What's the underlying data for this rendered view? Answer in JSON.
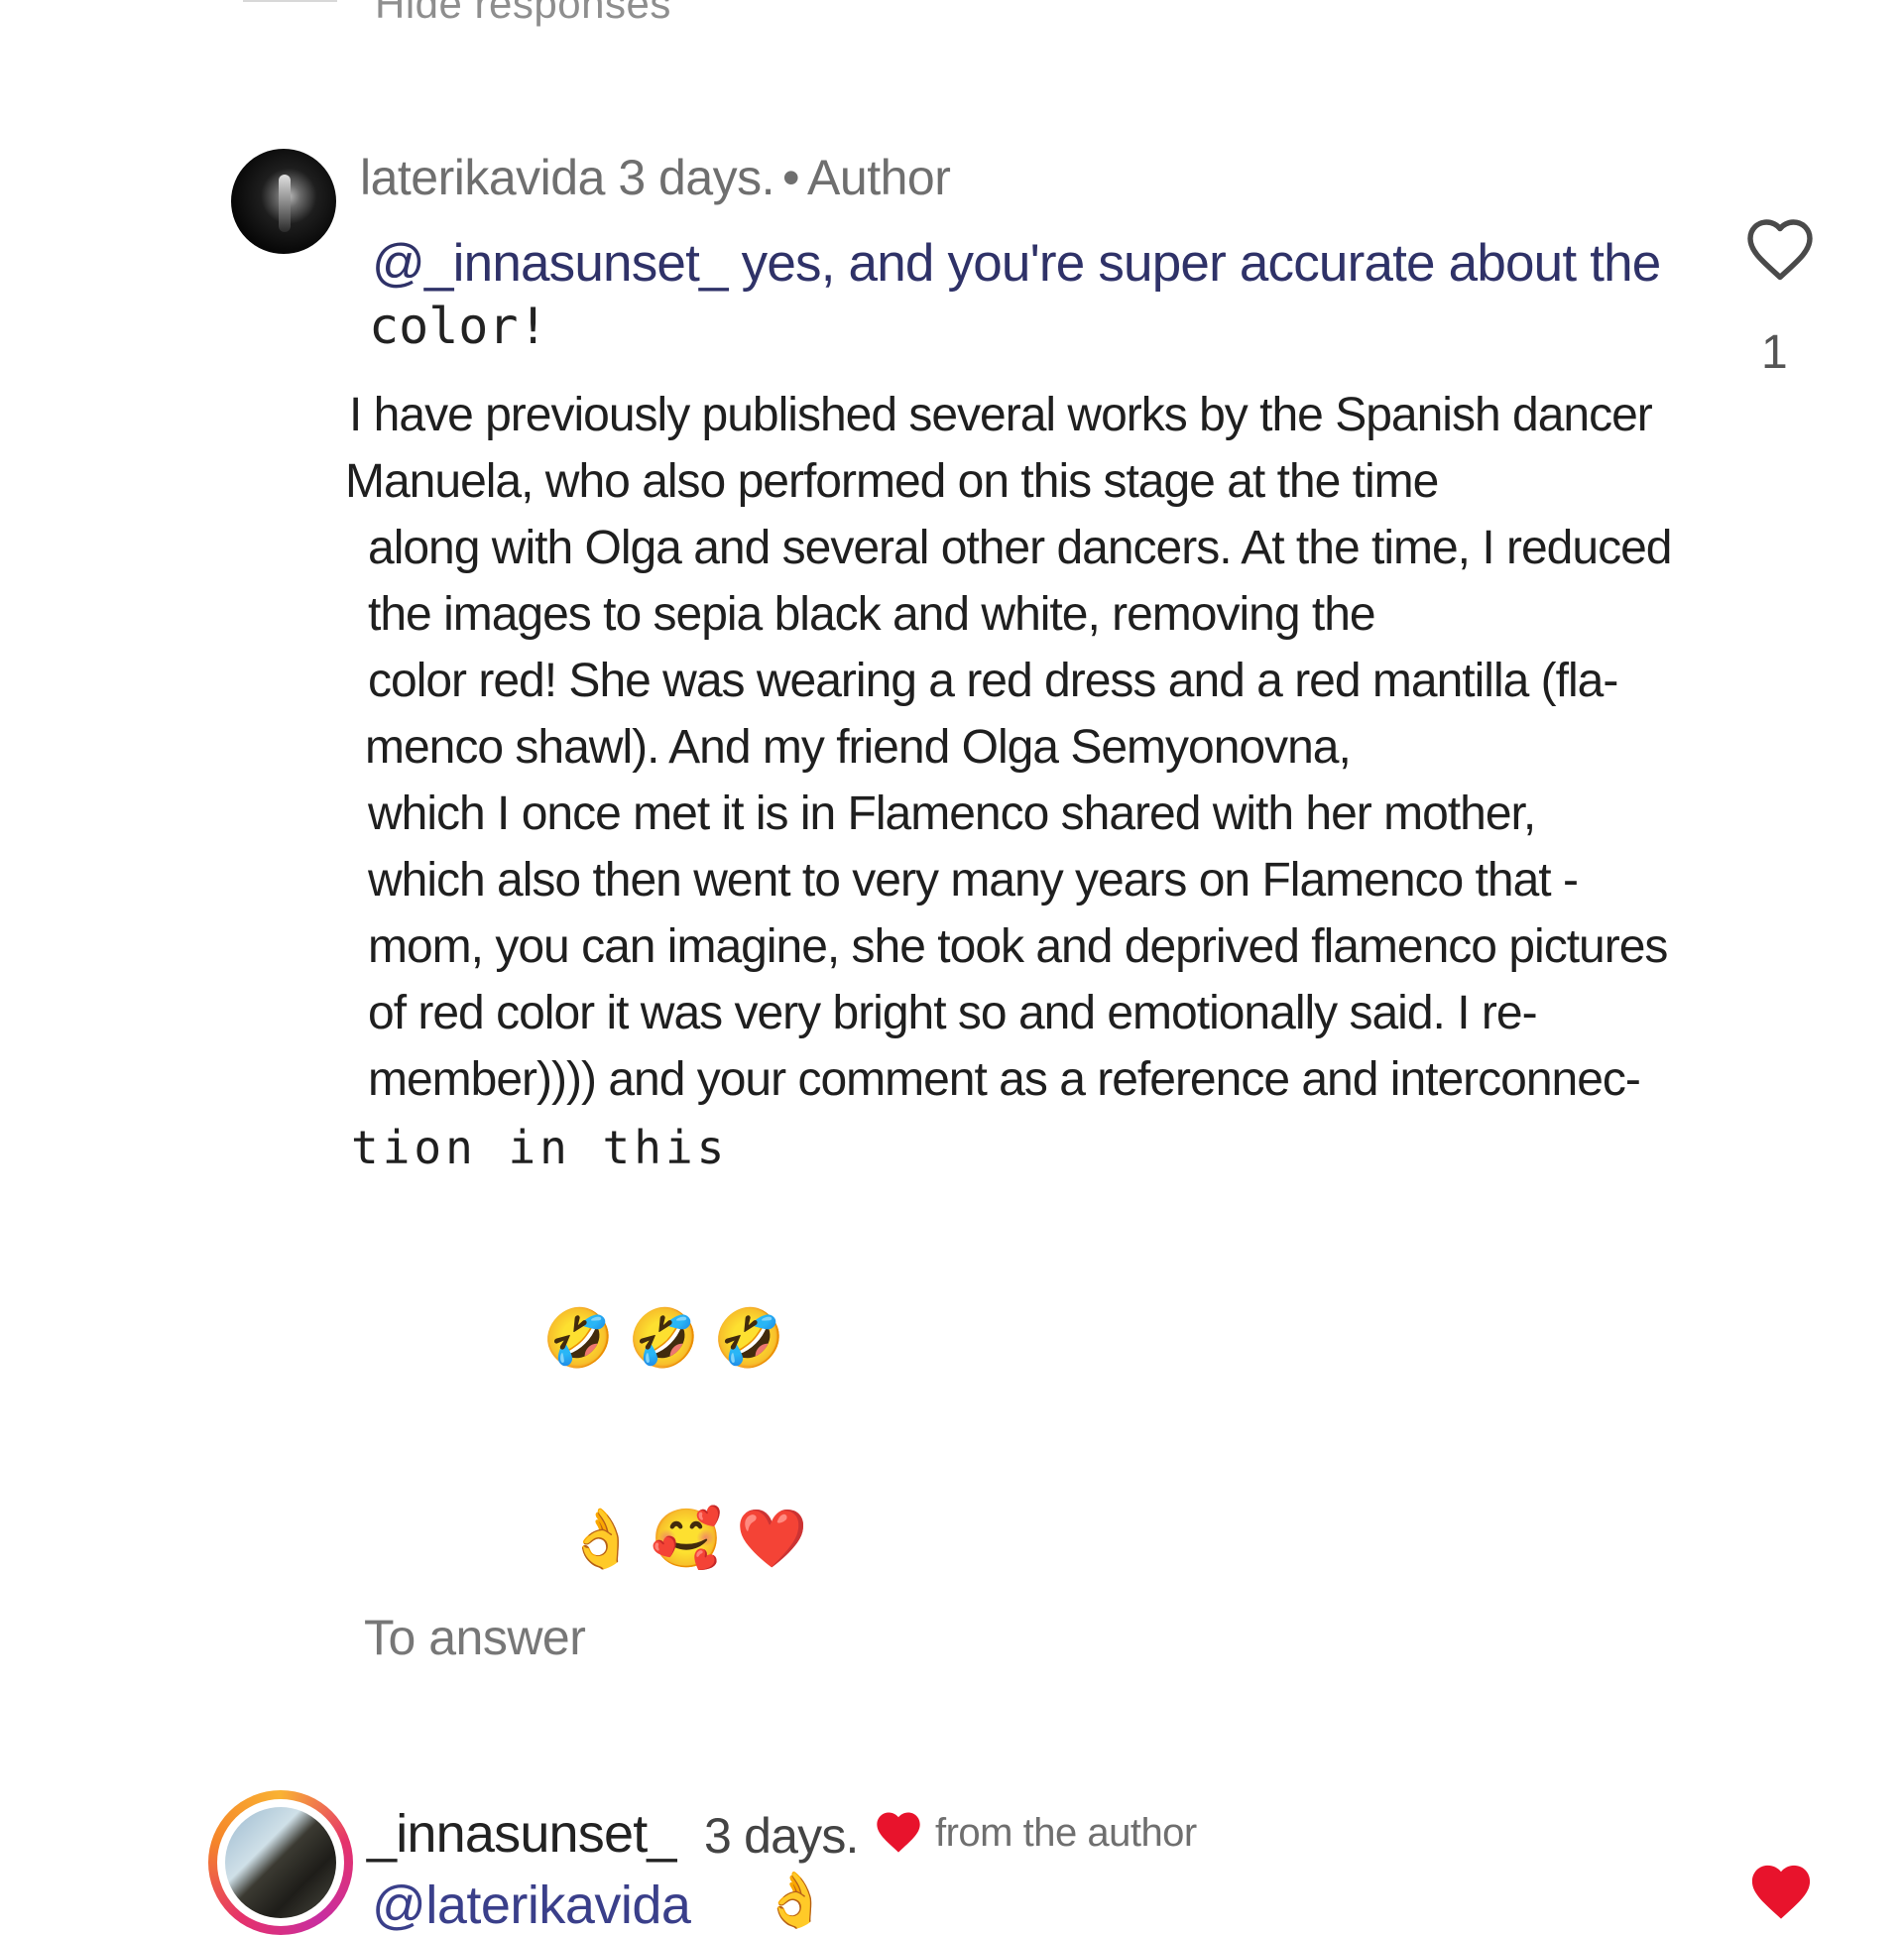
{
  "thread": {
    "hide_responses_label": "Hide responses"
  },
  "comment1": {
    "username": "laterikavida",
    "time": "3 days.",
    "separator": "•",
    "role": "Author",
    "reply_line": "@_innasunset_ yes, and you're super accurate about the",
    "reply_tail": "color!",
    "body_lines": [
      "I have previously published several works by the Spanish dancer",
      "Manuela, who also performed on this stage at the time",
      "along with Olga and several other dancers. At the time, I reduced",
      "the images to sepia black and white, removing the",
      "color red! She was wearing a red dress and a red mantilla (fla-",
      "menco shawl). And my friend Olga Semyonovna,",
      "which I once met it is in Flamenco shared with her mother,",
      "which also then went to very many years on Flamenco that -",
      "mom, you can imagine, she took and deprived flamenco pictures",
      "of red color it was very bright so and emotionally said. I re-",
      "member)))) and your comment as a reference and interconnec-",
      "tion  in  this"
    ],
    "emoji_row1": "🤣🤣🤣",
    "emoji_row2": "👌🥰❤️",
    "answer_label": "To answer",
    "like_count": "1",
    "like_icon": "heart-outline-icon"
  },
  "comment2": {
    "username": "_innasunset_",
    "time": "3 days.",
    "from_author_label": "from the author",
    "reply_partial": "@laterikavida",
    "reply_emoji": "👌",
    "like_icon": "heart-filled-icon",
    "accent_red": "#e8132c"
  }
}
